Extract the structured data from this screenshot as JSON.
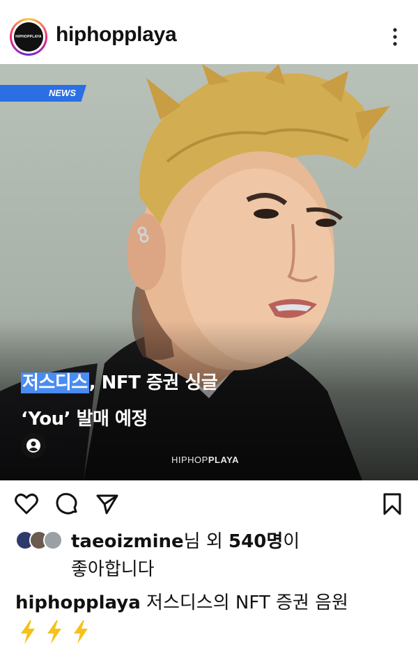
{
  "header": {
    "avatar_text": "HIPHOPPLAYA",
    "username": "hiphopplaya"
  },
  "post": {
    "badge": "NEWS",
    "headline_highlight": "저스디스",
    "headline_rest_line1": ", NFT 증권 싱글",
    "headline_line2": "‘You’ 발매 예정",
    "watermark_light": "HIPHOP",
    "watermark_bold": "PLAYA"
  },
  "likes": {
    "user": "taeoizmine",
    "suffix1": "님 외 ",
    "count": "540명",
    "suffix2": "이",
    "line2": "좋아합니다"
  },
  "caption": {
    "user": "hiphopplaya",
    "text": " 저스디스의 NFT 증권 음원"
  },
  "colors": {
    "badge_blue": "#2a6fe4",
    "highlight_blue": "#4a8cf0",
    "bolt_yellow": "#f5c21b"
  }
}
